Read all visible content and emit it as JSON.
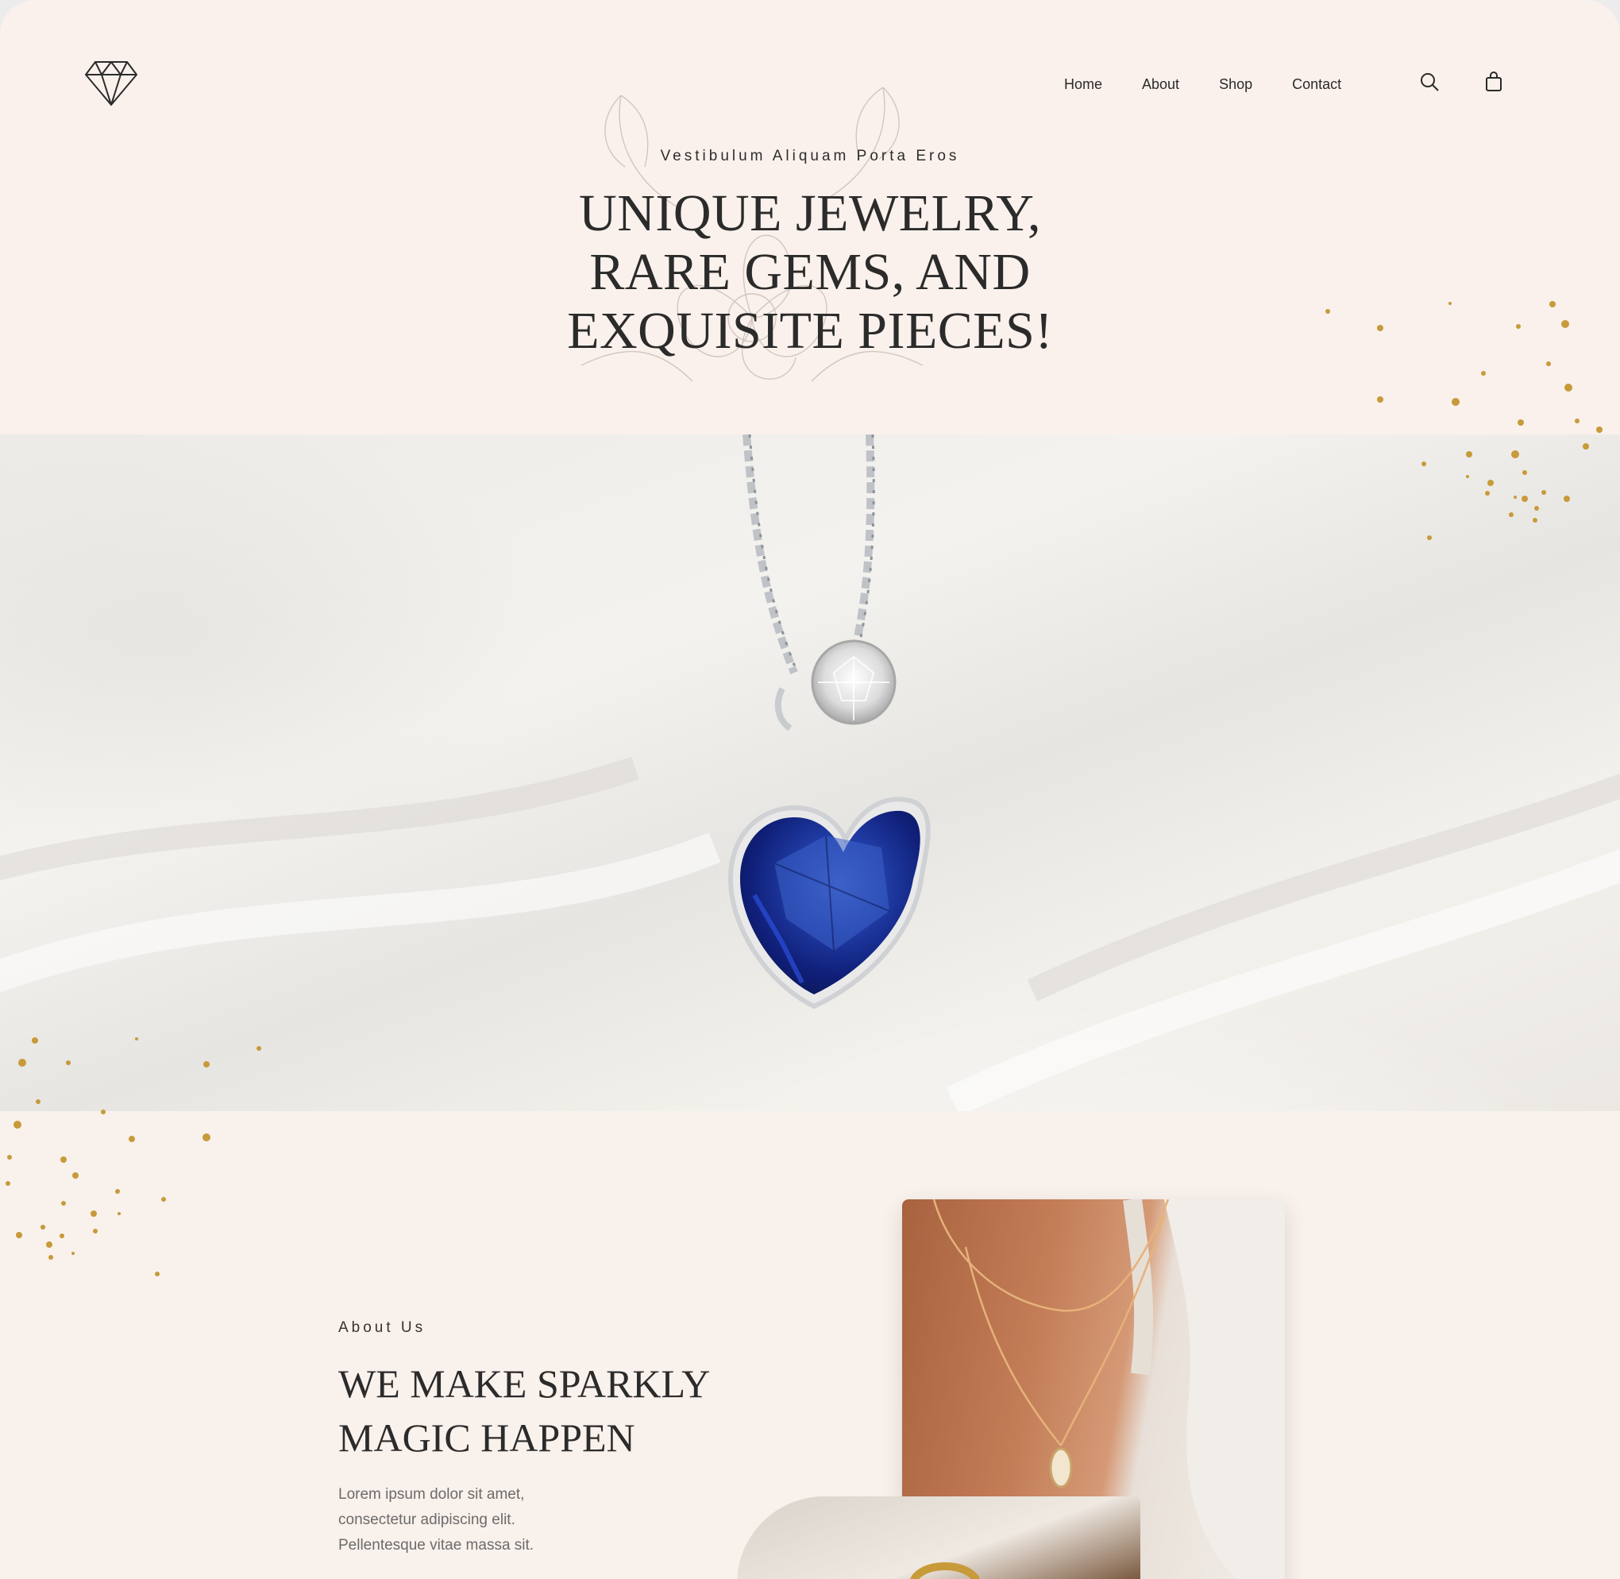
{
  "header": {
    "logo": "diamond-icon",
    "nav": [
      "Home",
      "About",
      "Shop",
      "Contact"
    ],
    "icons": [
      "search-icon",
      "shopping-bag-icon"
    ]
  },
  "hero": {
    "eyebrow": "Vestibulum Aliquam Porta Eros",
    "title_lines": [
      "UNIQUE JEWELRY,",
      "RARE GEMS, AND",
      "EXQUISITE PIECES!"
    ],
    "image": "heart-sapphire-pendant-photo"
  },
  "about": {
    "eyebrow": "About Us",
    "title_lines": [
      "WE MAKE SPARKLY",
      "MAGIC HAPPEN"
    ],
    "text_lines": [
      "Lorem ipsum dolor sit amet,",
      "consectetur adipiscing elit.",
      "Pellentesque vitae massa sit."
    ],
    "images": [
      "necklace-on-neck-photo",
      "gold-ring-photo"
    ]
  },
  "colors": {
    "background": "#faf1ec",
    "text": "#2b2b2b",
    "muted": "#6b6b6b",
    "sparkle": "#c79a3a",
    "gem": "#1a2f9c"
  }
}
